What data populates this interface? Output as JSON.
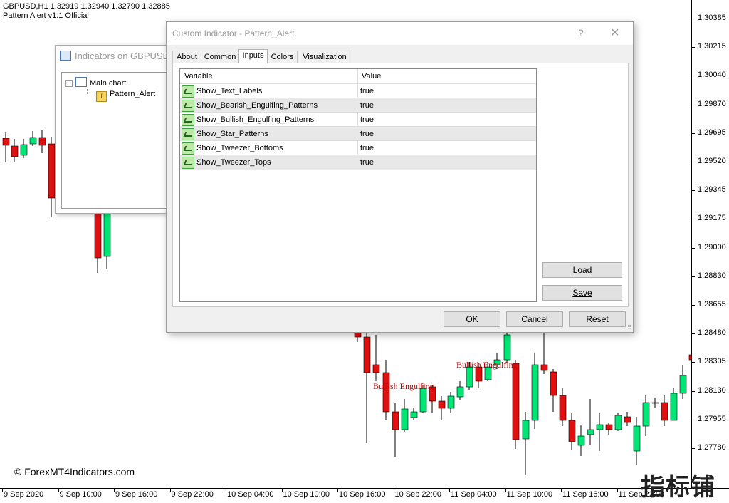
{
  "chart": {
    "header_line1": "GBPUSD,H1  1.32919 1.32940 1.32790 1.32885",
    "header_line2": "Pattern Alert v1.1 Official",
    "copyright": "© ForexMT4Indicators.com",
    "watermark": "指标铺",
    "bullish_color": "#00e676",
    "bearish_color": "#e01010",
    "label_color": "#c00000",
    "pattern_labels": [
      {
        "text": "Bullish Engulfing"
      },
      {
        "text": "Bullish Engulfing"
      }
    ],
    "price_labels": [
      "1.30385",
      "1.30215",
      "1.30040",
      "1.29870",
      "1.29695",
      "1.29520",
      "1.29345",
      "1.29175",
      "1.29000",
      "1.28830",
      "1.28655",
      "1.28480",
      "1.28305",
      "1.28130",
      "1.27955",
      "1.27780"
    ],
    "time_labels": [
      "9 Sep 2020",
      "9 Sep 10:00",
      "9 Sep 16:00",
      "9 Sep 22:00",
      "10 Sep 04:00",
      "10 Sep 10:00",
      "10 Sep 16:00",
      "10 Sep 22:00",
      "11 Sep 04:00",
      "11 Sep 10:00",
      "11 Sep 16:00",
      "11 Sep 22:00"
    ]
  },
  "indicators_window": {
    "title": "Indicators on GBPUSD,H1",
    "tree_root": "Main chart",
    "tree_child": "Pattern_Alert",
    "expander": "−"
  },
  "dialog": {
    "title": "Custom Indicator - Pattern_Alert",
    "help": "?",
    "close": "✕",
    "tabs": [
      "About",
      "Common",
      "Inputs",
      "Colors",
      "Visualization"
    ],
    "active_tab": "Inputs",
    "grid": {
      "col_variable": "Variable",
      "col_value": "Value",
      "rows": [
        {
          "variable": "Show_Text_Labels",
          "value": "true"
        },
        {
          "variable": "Show_Bearish_Engulfing_Patterns",
          "value": "true"
        },
        {
          "variable": "Show_Bullish_Engulfing_Patterns",
          "value": "true"
        },
        {
          "variable": "Show_Star_Patterns",
          "value": "true"
        },
        {
          "variable": "Show_Tweezer_Bottoms",
          "value": "true"
        },
        {
          "variable": "Show_Tweezer_Tops",
          "value": "true"
        }
      ]
    },
    "buttons": {
      "load": "Load",
      "save": "Save",
      "ok": "OK",
      "cancel": "Cancel",
      "reset": "Reset"
    }
  }
}
